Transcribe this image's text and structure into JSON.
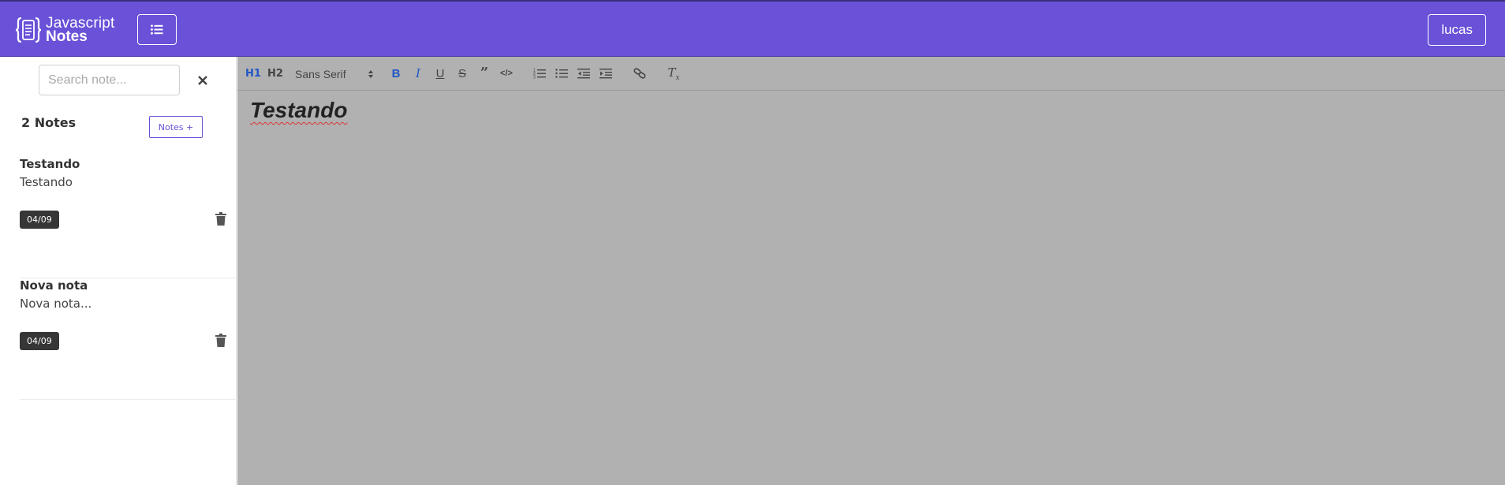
{
  "header": {
    "logo_line1": "Javascript",
    "logo_line2": "Notes",
    "menu_icon": "list-icon",
    "user_label": "lucas",
    "brand_color": "#6a51d8"
  },
  "sidebar": {
    "search_placeholder": "Search note...",
    "search_value": "",
    "notes_count_label": "2 Notes",
    "add_button_label": "Notes +",
    "notes": [
      {
        "title": "Testando",
        "preview": "Testando",
        "date": "04/09"
      },
      {
        "title": "Nova nota",
        "preview": "Nova nota...",
        "date": "04/09"
      }
    ]
  },
  "editor": {
    "toolbar": {
      "h1_label": "H1",
      "h2_label": "H2",
      "font_label": "Sans Serif",
      "buttons": [
        "bold-icon",
        "italic-icon",
        "underline-icon",
        "strike-icon",
        "blockquote-icon",
        "code-icon",
        "ordered-list-icon",
        "bullet-list-icon",
        "outdent-icon",
        "indent-icon",
        "link-icon",
        "clear-format-icon"
      ]
    },
    "content": "Testando"
  }
}
